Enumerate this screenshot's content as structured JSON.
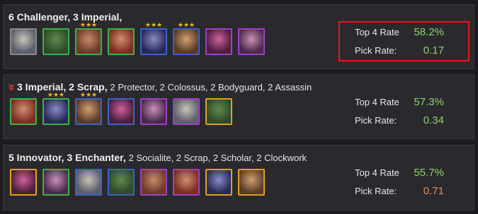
{
  "comps": [
    {
      "title_bold": "6 Challenger, 3 Imperial,",
      "title_rest": "",
      "top4_label": "Top 4 Rate",
      "top4_value": "58.2%",
      "pick_label": "Pick Rate:",
      "pick_value": "0.17",
      "champions": [
        {
          "name": "champion-1",
          "stars": "",
          "border": "#8a8a8a"
        },
        {
          "name": "champion-2",
          "stars": "",
          "border": "#3cb04a"
        },
        {
          "name": "champion-3",
          "stars": "★★★",
          "border": "#3cb04a"
        },
        {
          "name": "champion-4",
          "stars": "",
          "border": "#3cb04a"
        },
        {
          "name": "champion-5",
          "stars": "★★★",
          "border": "#3a62c8"
        },
        {
          "name": "champion-6",
          "stars": "★★★",
          "border": "#3a62c8"
        },
        {
          "name": "champion-7",
          "stars": "",
          "border": "#a03ec8"
        },
        {
          "name": "champion-8",
          "stars": "",
          "border": "#a03ec8"
        }
      ]
    },
    {
      "title_bold": "3 Imperial, 2 Scrap,",
      "title_rest": "2 Protector, 2 Colossus, 2 Bodyguard, 2 Assassin",
      "top4_label": "Top 4 Rate",
      "top4_value": "57.3%",
      "pick_label": "Pick Rate:",
      "pick_value": "0.34",
      "champions": [
        {
          "name": "champion-1",
          "stars": "",
          "border": "#3cb04a"
        },
        {
          "name": "champion-2",
          "stars": "★★★",
          "border": "#3cb04a"
        },
        {
          "name": "champion-3",
          "stars": "★★★",
          "border": "#3a62c8"
        },
        {
          "name": "champion-4",
          "stars": "",
          "border": "#3a62c8"
        },
        {
          "name": "champion-5",
          "stars": "",
          "border": "#a03ec8"
        },
        {
          "name": "champion-6",
          "stars": "",
          "border": "#a03ec8"
        },
        {
          "name": "champion-7",
          "stars": "",
          "border": "#e0a020"
        }
      ]
    },
    {
      "title_bold": "5 Innovator, 3 Enchanter,",
      "title_rest": "2 Socialite, 2 Scrap, 2 Scholar, 2 Clockwork",
      "top4_label": "Top 4 Rate",
      "top4_value": "55.7%",
      "pick_label": "Pick Rate:",
      "pick_value": "0.71",
      "champions": [
        {
          "name": "champion-1",
          "stars": "",
          "border": "#e0a020"
        },
        {
          "name": "champion-2",
          "stars": "",
          "border": "#3cb04a"
        },
        {
          "name": "champion-3",
          "stars": "",
          "border": "#3a62c8"
        },
        {
          "name": "champion-4",
          "stars": "",
          "border": "#3a62c8"
        },
        {
          "name": "champion-5",
          "stars": "",
          "border": "#a03ec8"
        },
        {
          "name": "champion-6",
          "stars": "",
          "border": "#a03ec8"
        },
        {
          "name": "champion-7",
          "stars": "",
          "border": "#e0a020"
        },
        {
          "name": "champion-8",
          "stars": "",
          "border": "#e0a020"
        }
      ]
    }
  ],
  "colors": {
    "value_green": "#8fd16a",
    "value_orange": "#e48c55",
    "star": "#f0b728",
    "highlight": "#e01b1b",
    "down_chevron": "#e0342e"
  },
  "icons": {
    "trend": "chevron-double-down-icon"
  }
}
